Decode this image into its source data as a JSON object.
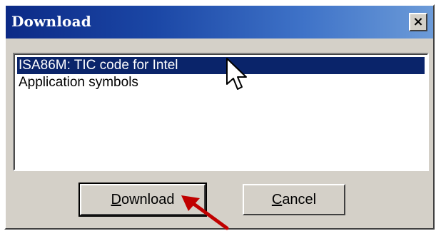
{
  "dialog": {
    "title": "Download",
    "close_label": "×"
  },
  "list": {
    "items": [
      {
        "label": "ISA86M: TIC code for Intel",
        "selected": true
      },
      {
        "label": "Application symbols",
        "selected": false
      }
    ]
  },
  "buttons": {
    "download": {
      "mnemonic": "D",
      "rest": "ownload"
    },
    "cancel": {
      "mnemonic": "C",
      "rest": "ancel"
    }
  },
  "icons": {
    "close": "close-icon",
    "cursor": "mouse-pointer-icon",
    "annotation": "red-arrow-icon"
  },
  "colors": {
    "title_bar_start": "#0c2a86",
    "title_bar_end": "#6c9bd8",
    "selection": "#0a246a",
    "annotation_arrow": "#c00000",
    "dialog_face": "#d4d0c8"
  }
}
